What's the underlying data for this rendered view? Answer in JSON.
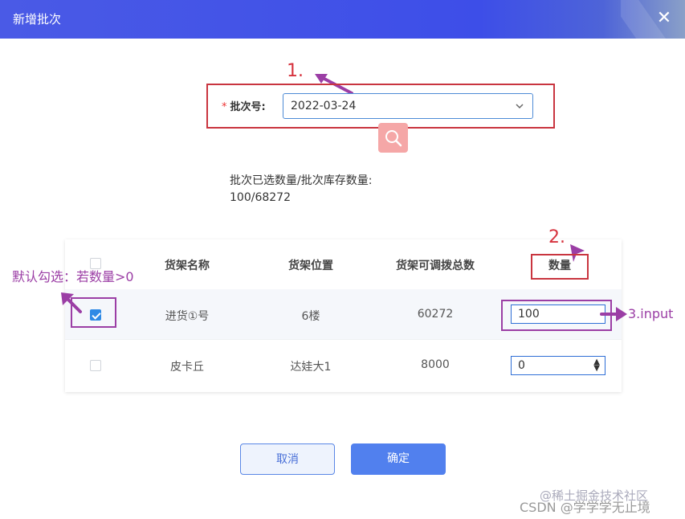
{
  "dialog": {
    "title": "新增批次",
    "close_glyph": "✕"
  },
  "form": {
    "required_mark": "*",
    "batch_label": "批次号:",
    "batch_value": "2022-03-24"
  },
  "info": {
    "line1": "批次已选数量/批次库存数量:",
    "line2": "100/68272"
  },
  "table": {
    "headers": [
      "货架名称",
      "货架位置",
      "货架可调拨总数",
      "数量"
    ],
    "rows": [
      {
        "checked": true,
        "name": "进货①号",
        "position": "6楼",
        "total": "60272",
        "qty": "100"
      },
      {
        "checked": false,
        "name": "皮卡丘",
        "position": "达娃大1",
        "total": "8000",
        "qty": "0"
      }
    ]
  },
  "buttons": {
    "cancel": "取消",
    "confirm": "确定"
  },
  "annotations": {
    "step1": "1.",
    "step2": "2.",
    "step3": "3.input",
    "default_check": "默认勾选：若数量>0"
  },
  "watermark": {
    "line1": "@稀土掘金技术社区",
    "line2": "CSDN @学学学无止境"
  },
  "colors": {
    "header": "#3d4ee8",
    "annotation_red": "#c9353f",
    "annotation_purple": "#9b3ea5",
    "primary": "#5180ee"
  },
  "icons": {
    "close": "close-icon",
    "chevron": "chevron-down-icon",
    "search": "search-icon",
    "arrow": "arrow-icon"
  }
}
